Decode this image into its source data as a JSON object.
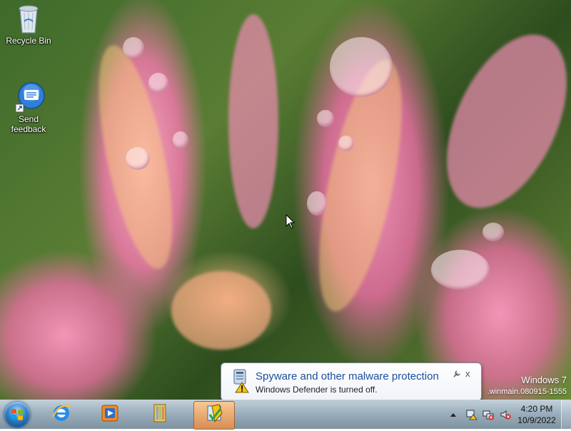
{
  "desktop": {
    "icons": [
      {
        "label": "Recycle Bin",
        "icon": "recycle-bin-icon"
      },
      {
        "label": "Send\nfeedback",
        "label_line1": "Send",
        "label_line2": "feedback",
        "icon": "feedback-icon"
      }
    ]
  },
  "watermark": {
    "line1": "Windows 7",
    "line2": ".winmain.080915-1555"
  },
  "notification": {
    "title": "Spyware and other malware protection",
    "message": "Windows Defender is turned off.",
    "options_icon": "wrench-icon",
    "close_label": "x"
  },
  "taskbar": {
    "start_icon": "windows-start-orb-icon",
    "pinned": [
      {
        "name": "internet-explorer",
        "icon": "internet-explorer-icon"
      },
      {
        "name": "media-player",
        "icon": "media-player-icon"
      },
      {
        "name": "file-explorer",
        "icon": "library-folder-icon"
      },
      {
        "name": "action-center",
        "icon": "action-center-icon",
        "active": true
      }
    ],
    "tray": {
      "icons": [
        "show-hidden-icons-arrow",
        "action-center-flag-icon",
        "network-icon",
        "volume-muted-icon"
      ],
      "time": "4:20 PM",
      "date": "10/9/2022"
    }
  },
  "colors": {
    "balloon_title": "#1a4f9c",
    "taskbar_active": "#e69a50"
  }
}
